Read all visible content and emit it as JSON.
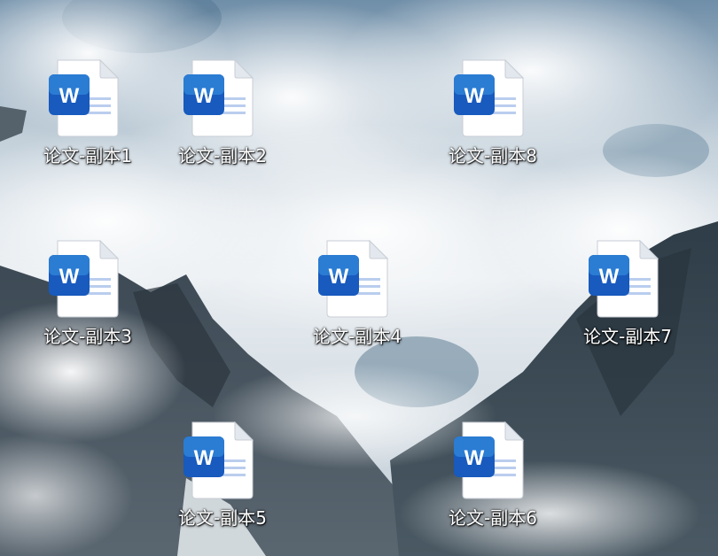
{
  "desktop": {
    "icons": [
      {
        "label": "论文-副本1",
        "type": "word-document-icon"
      },
      {
        "label": "论文-副本2",
        "type": "word-document-icon"
      },
      {
        "label": "论文-副本8",
        "type": "word-document-icon"
      },
      {
        "label": "论文-副本3",
        "type": "word-document-icon"
      },
      {
        "label": "论文-副本4",
        "type": "word-document-icon"
      },
      {
        "label": "论文-副本7",
        "type": "word-document-icon"
      },
      {
        "label": "论文-副本5",
        "type": "word-document-icon"
      },
      {
        "label": "论文-副本6",
        "type": "word-document-icon"
      }
    ],
    "word_badge_letter": "W",
    "colors": {
      "word_blue": "#185abd",
      "word_blue_light": "#2b7cd3",
      "page_white": "#ffffff",
      "label_text": "#ffffff"
    }
  }
}
